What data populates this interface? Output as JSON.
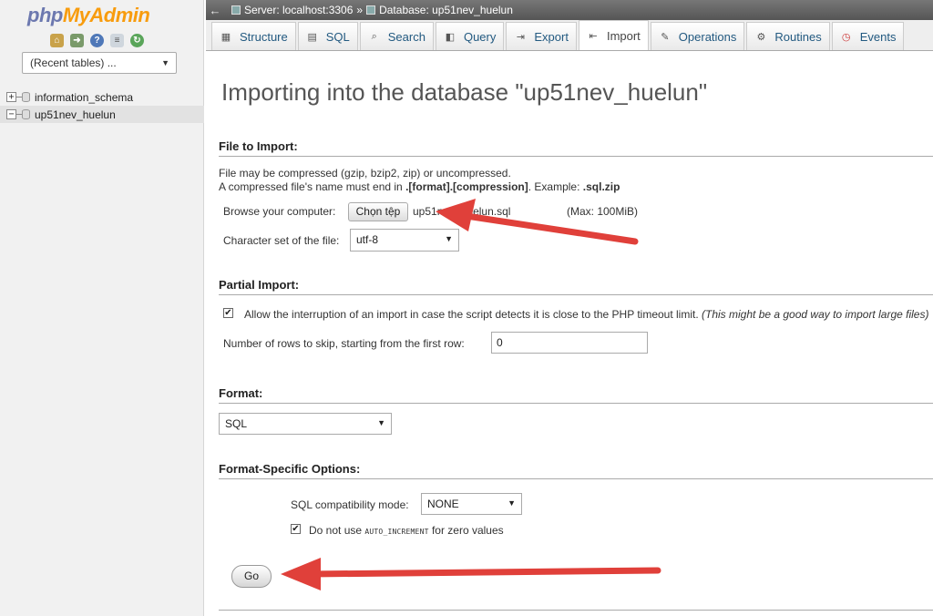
{
  "sidebar": {
    "logo_php": "php",
    "logo_myadmin": "MyAdmin",
    "recent_tables": "(Recent tables) ...",
    "databases": [
      {
        "name": "information_schema",
        "ctrl": "+"
      },
      {
        "name": "up51nev_huelun",
        "ctrl": "−"
      }
    ]
  },
  "breadcrumb": {
    "server": "Server: localhost:3306",
    "separator": "»",
    "database": "Database: up51nev_huelun"
  },
  "tabs": [
    {
      "label": "Structure",
      "icon": "structure-icon"
    },
    {
      "label": "SQL",
      "icon": "sql-icon"
    },
    {
      "label": "Search",
      "icon": "search-icon"
    },
    {
      "label": "Query",
      "icon": "query-icon"
    },
    {
      "label": "Export",
      "icon": "export-icon"
    },
    {
      "label": "Import",
      "icon": "import-icon",
      "active": true
    },
    {
      "label": "Operations",
      "icon": "wrench-icon"
    },
    {
      "label": "Routines",
      "icon": "routines-icon"
    },
    {
      "label": "Events",
      "icon": "clock-icon"
    }
  ],
  "main": {
    "title": "Importing into the database \"up51nev_huelun\"",
    "file_section": {
      "heading": "File to Import:",
      "line1": "File may be compressed (gzip, bzip2, zip) or uncompressed.",
      "line2_prefix": "A compressed file's name must end in ",
      "line2_bold": ".[format].[compression]",
      "line2_mid": ". Example: ",
      "line2_example": ".sql.zip",
      "browse_label": "Browse your computer:",
      "choose_button": "Chọn tệp",
      "file_name": "up51nev_huelun.sql",
      "max_size": "(Max: 100MiB)",
      "charset_label": "Character set of the file:",
      "charset_value": "utf-8"
    },
    "partial_section": {
      "heading": "Partial Import:",
      "allow_text": "Allow the interruption of an import in case the script detects it is close to the PHP timeout limit.",
      "allow_note": "(This might be a good way to import large files)",
      "allow_checked": true,
      "skip_label": "Number of rows to skip, starting from the first row:",
      "skip_value": "0"
    },
    "format_section": {
      "heading": "Format:",
      "format_value": "SQL"
    },
    "options_section": {
      "heading": "Format-Specific Options:",
      "compat_label": "SQL compatibility mode:",
      "compat_value": "NONE",
      "autoinc_prefix": "Do not use ",
      "autoinc_code": "AUTO_INCREMENT",
      "autoinc_suffix": " for zero values",
      "autoinc_checked": true
    },
    "go_button": "Go"
  },
  "colors": {
    "accent_link": "#235a81",
    "logo_blue": "#6c78af",
    "logo_orange": "#f89c0e",
    "annotation_arrow": "#e0403a"
  }
}
